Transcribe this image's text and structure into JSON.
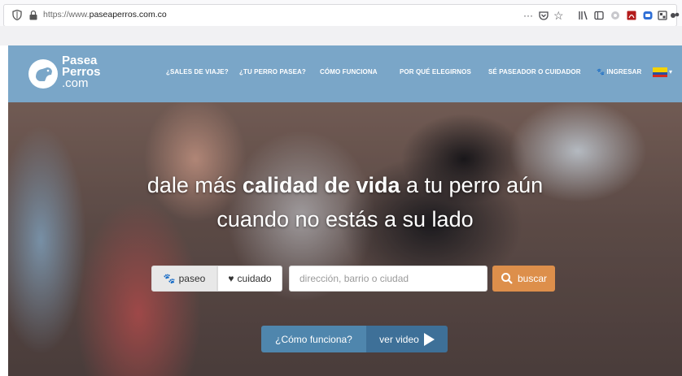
{
  "browser": {
    "url_prefix": "https://www.",
    "url_domain": "paseaperros.com.co",
    "toolbar_icons": [
      "more-actions-icon",
      "pocket-icon",
      "bookmark-star-icon",
      "library-icon",
      "reader-view-icon",
      "extension-icon",
      "pdf-icon",
      "extension-blue-icon",
      "screenshot-icon",
      "extension-dog-icon"
    ]
  },
  "header": {
    "logo_line1": "Pasea",
    "logo_line2": "Perros",
    "logo_line3": ".com",
    "nav": [
      {
        "label": "¿SALES DE VIAJE?"
      },
      {
        "label": "¿TU PERRO PASEA?"
      },
      {
        "label": "CÓMO FUNCIONA"
      },
      {
        "label": "POR QUÉ ELEGIRNOS"
      },
      {
        "label": "SÉ PASEADOR O CUIDADOR"
      },
      {
        "label": "INGRESAR"
      }
    ],
    "flag": "colombia-flag-icon",
    "colors": {
      "header_bg": "#7aa6c8",
      "accent": "#dd8f4b",
      "button_blue": "#4f86ad"
    }
  },
  "hero": {
    "line1_a": "dale más ",
    "line1_b": "calidad de vida",
    "line1_c": " a tu perro aún",
    "line2": "cuando no estás a su lado"
  },
  "search": {
    "tab_paseo": "paseo",
    "tab_cuidado": "cuidado",
    "address_placeholder": "dirección, barrio o ciudad",
    "button": "buscar"
  },
  "how": {
    "question": "¿Cómo funciona?",
    "video": "ver video"
  }
}
